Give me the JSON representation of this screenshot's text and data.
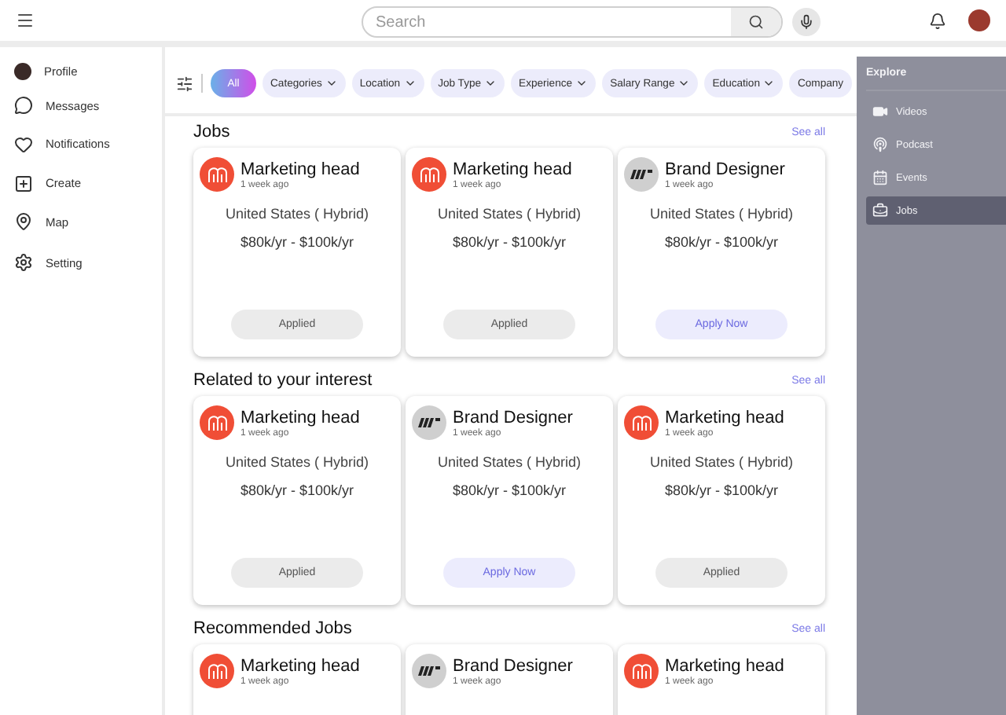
{
  "top_bar": {
    "search": {
      "placeholder": "Search"
    }
  },
  "sidebar": {
    "items": [
      {
        "label": "Profile",
        "kind": "avatar"
      },
      {
        "label": "Messages",
        "kind": "messages"
      },
      {
        "label": "Notifications",
        "kind": "heart"
      },
      {
        "label": "Create",
        "kind": "create"
      },
      {
        "label": "Map",
        "kind": "map"
      },
      {
        "label": "Setting",
        "kind": "settings"
      }
    ]
  },
  "filters": [
    {
      "label": "All",
      "selected": true
    },
    {
      "label": "Categories",
      "selected": false
    },
    {
      "label": "Location",
      "selected": false
    },
    {
      "label": "Job Type",
      "selected": false
    },
    {
      "label": "Experience",
      "selected": false
    },
    {
      "label": "Salary Range",
      "selected": false
    },
    {
      "label": "Education",
      "selected": false
    },
    {
      "label": "Company",
      "selected": false
    }
  ],
  "sections": [
    {
      "title": "Jobs",
      "see_all": "See all",
      "cards": [
        {
          "kind": "monogram",
          "title": "Marketing head",
          "time": "1 week ago",
          "location": "United States ( Hybrid)",
          "salary": "$80k/yr - $100k/yr",
          "button": {
            "label": "Applied",
            "applied": true
          }
        },
        {
          "kind": "monogram",
          "title": "Marketing head",
          "time": "1 week ago",
          "location": "United States ( Hybrid)",
          "salary": "$80k/yr - $100k/yr",
          "button": {
            "label": "Applied",
            "applied": true
          }
        },
        {
          "kind": "stripes",
          "title": "Brand Designer",
          "time": "1 week ago",
          "location": "United States ( Hybrid)",
          "salary": "$80k/yr - $100k/yr",
          "button": {
            "label": "Apply Now",
            "applied": false
          }
        }
      ]
    },
    {
      "title": "Related to your interest",
      "see_all": "See all",
      "cards": [
        {
          "kind": "monogram",
          "title": "Marketing head",
          "time": "1 week ago",
          "location": "United States ( Hybrid)",
          "salary": "$80k/yr - $100k/yr",
          "button": {
            "label": "Applied",
            "applied": true
          }
        },
        {
          "kind": "stripes",
          "title": "Brand Designer",
          "time": "1 week ago",
          "location": "United States ( Hybrid)",
          "salary": "$80k/yr - $100k/yr",
          "button": {
            "label": "Apply Now",
            "applied": false
          }
        },
        {
          "kind": "monogram",
          "title": "Marketing head",
          "time": "1 week ago",
          "location": "United States ( Hybrid)",
          "salary": "$80k/yr - $100k/yr",
          "button": {
            "label": "Applied",
            "applied": true
          }
        }
      ]
    },
    {
      "title": "Recommended Jobs",
      "see_all": "See all",
      "cards": [
        {
          "kind": "monogram",
          "title": "Marketing head",
          "time": "1 week ago"
        },
        {
          "kind": "stripes",
          "title": "Brand Designer",
          "time": "1 week ago"
        },
        {
          "kind": "monogram",
          "title": "Marketing head",
          "time": "1 week ago"
        }
      ]
    }
  ],
  "explore": {
    "title": "Explore",
    "items": [
      {
        "label": "Videos",
        "kind": "video",
        "selected": false
      },
      {
        "label": "Podcast",
        "kind": "podcast",
        "selected": false
      },
      {
        "label": "Events",
        "kind": "calendar",
        "selected": false
      },
      {
        "label": "Jobs",
        "kind": "jobs",
        "selected": true
      }
    ]
  }
}
